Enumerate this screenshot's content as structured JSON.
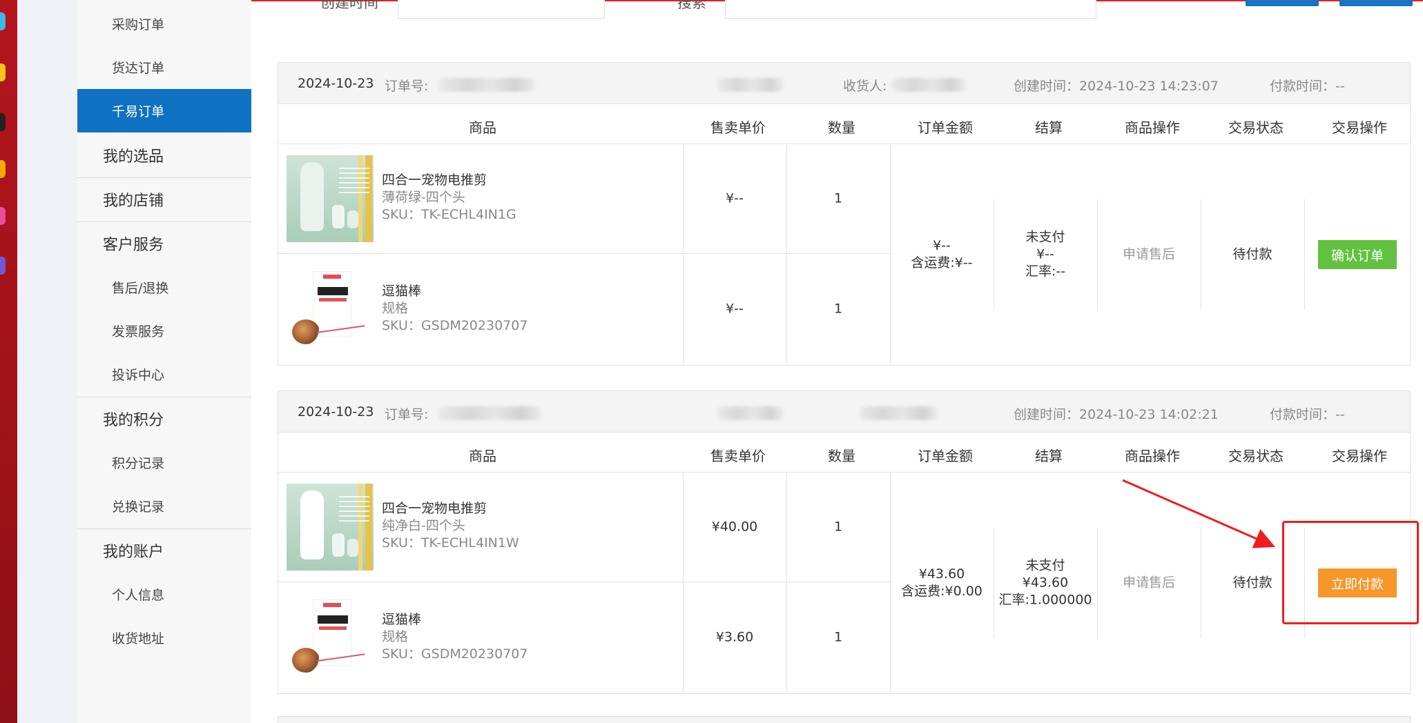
{
  "sidebar": {
    "items": [
      {
        "label": "采购订单",
        "type": "sub"
      },
      {
        "label": "货达订单",
        "type": "sub"
      },
      {
        "label": "千易订单",
        "type": "sub",
        "active": true
      },
      {
        "label": "我的选品",
        "type": "group"
      },
      {
        "label": "我的店铺",
        "type": "group"
      },
      {
        "label": "客户服务",
        "type": "group"
      },
      {
        "label": "售后/退换",
        "type": "sub"
      },
      {
        "label": "发票服务",
        "type": "sub"
      },
      {
        "label": "投诉中心",
        "type": "sub"
      },
      {
        "label": "我的积分",
        "type": "group"
      },
      {
        "label": "积分记录",
        "type": "sub"
      },
      {
        "label": "兑换记录",
        "type": "sub"
      },
      {
        "label": "我的账户",
        "type": "group"
      },
      {
        "label": "个人信息",
        "type": "sub"
      },
      {
        "label": "收货地址",
        "type": "sub"
      }
    ]
  },
  "filter": {
    "created_label": "创建时间",
    "search_label": "搜索"
  },
  "columns": [
    "商品",
    "售卖单价",
    "数量",
    "订单金额",
    "结算",
    "商品操作",
    "交易状态",
    "交易操作"
  ],
  "orders": [
    {
      "date": "2024-10-23",
      "order_no_label": "订单号:",
      "receiver_label": "收货人:",
      "created": "创建时间：2024-10-23 14:23:07",
      "paid": "付款时间：--",
      "products": [
        {
          "name": "四合一宠物电推剪",
          "spec": "薄荷绿-四个头",
          "sku": "SKU：TK-ECHL4IN1G",
          "price": "¥--",
          "qty": "1"
        },
        {
          "name": "逗猫棒",
          "spec": "规格",
          "sku": "SKU：GSDM20230707",
          "price": "¥--",
          "qty": "1"
        }
      ],
      "amount": "¥--",
      "shipping": "含运费:¥--",
      "settle_status": "未支付",
      "settle_amount": "¥--",
      "rate": "汇率:--",
      "after_sale": "申请售后",
      "status": "待付款",
      "action": "确认订单",
      "action_color": "#62c13e"
    },
    {
      "date": "2024-10-23",
      "order_no_label": "订单号:",
      "created": "创建时间：2024-10-23 14:02:21",
      "paid": "付款时间：--",
      "products": [
        {
          "name": "四合一宠物电推剪",
          "spec": "纯净白-四个头",
          "sku": "SKU：TK-ECHL4IN1W",
          "price": "¥40.00",
          "qty": "1"
        },
        {
          "name": "逗猫棒",
          "spec": "规格",
          "sku": "SKU：GSDM20230707",
          "price": "¥3.60",
          "qty": "1"
        }
      ],
      "amount": "¥43.60",
      "shipping": "含运费:¥0.00",
      "settle_status": "未支付",
      "settle_amount": "¥43.60",
      "rate": "汇率:1.000000",
      "after_sale": "申请售后",
      "status": "待付款",
      "action": "立即付款",
      "action_color": "#f7962b"
    }
  ],
  "annotation_color": "#ee1d1d"
}
